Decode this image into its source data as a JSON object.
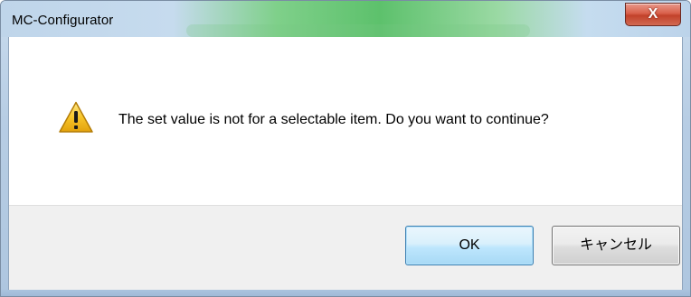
{
  "window": {
    "title": "MC-Configurator",
    "close_symbol": "X"
  },
  "dialog": {
    "icon": "warning-icon",
    "message": "The set value is not for a selectable item.  Do you want to continue?"
  },
  "buttons": {
    "ok_label": "OK",
    "cancel_label": "キャンセル"
  },
  "colors": {
    "warning_yellow": "#f7c52a",
    "close_red": "#c9442d",
    "default_button_border": "#3c7fb1",
    "button_bar_bg": "#f0f0f0"
  }
}
